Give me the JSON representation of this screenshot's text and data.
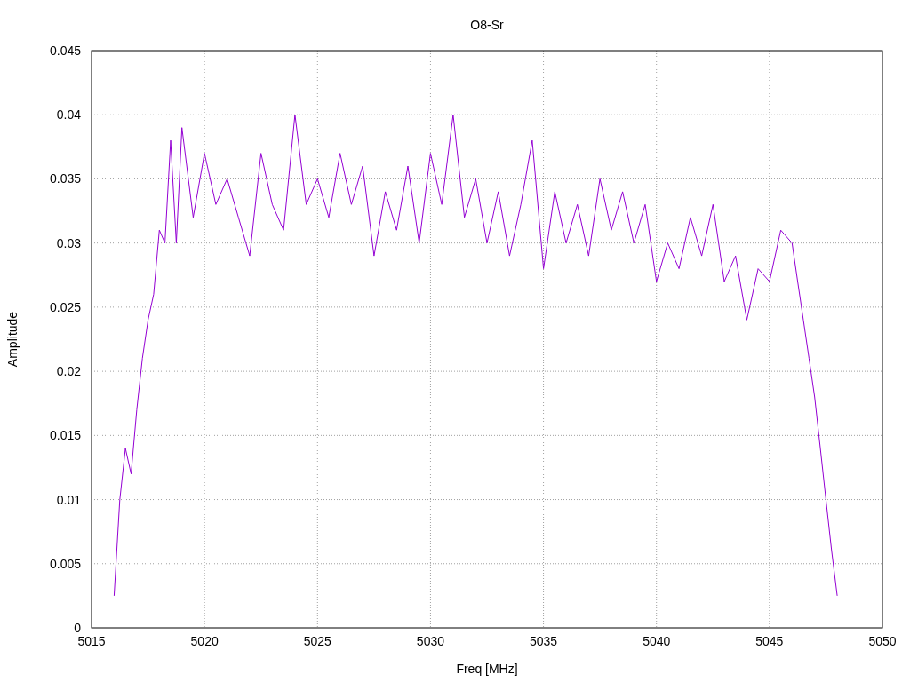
{
  "chart_data": {
    "type": "line",
    "title": "O8-Sr",
    "xlabel": "Freq [MHz]",
    "ylabel": "Amplitude",
    "grid": true,
    "xlim": [
      5015,
      5050
    ],
    "ylim": [
      0,
      0.045
    ],
    "xticks": [
      5015,
      5020,
      5025,
      5030,
      5035,
      5040,
      5045,
      5050
    ],
    "yticks": [
      0,
      0.005,
      0.01,
      0.015,
      0.02,
      0.025,
      0.03,
      0.035,
      0.04,
      0.045
    ],
    "x": [
      5016,
      5016.25,
      5016.5,
      5016.75,
      5017,
      5017.25,
      5017.5,
      5017.75,
      5018,
      5018.25,
      5018.5,
      5018.75,
      5019,
      5019.5,
      5020,
      5020.5,
      5021,
      5021.5,
      5022,
      5022.5,
      5023,
      5023.5,
      5024,
      5024.5,
      5025,
      5025.5,
      5026,
      5026.5,
      5027,
      5027.5,
      5028,
      5028.5,
      5029,
      5029.5,
      5030,
      5030.5,
      5031,
      5031.5,
      5032,
      5032.5,
      5033,
      5033.5,
      5034,
      5034.5,
      5035,
      5035.5,
      5036,
      5036.5,
      5037,
      5037.5,
      5038,
      5038.5,
      5039,
      5039.5,
      5040,
      5040.5,
      5041,
      5041.5,
      5042,
      5042.5,
      5043,
      5043.5,
      5044,
      5044.5,
      5045,
      5045.5,
      5046,
      5046.25,
      5046.5,
      5046.75,
      5047,
      5047.25,
      5047.5,
      5047.75,
      5048
    ],
    "series": [
      {
        "color": "#9400d3",
        "values": [
          0.0025,
          0.01,
          0.014,
          0.012,
          0.017,
          0.021,
          0.024,
          0.026,
          0.031,
          0.03,
          0.038,
          0.03,
          0.039,
          0.032,
          0.037,
          0.033,
          0.035,
          0.032,
          0.029,
          0.037,
          0.033,
          0.031,
          0.04,
          0.033,
          0.035,
          0.032,
          0.037,
          0.033,
          0.036,
          0.029,
          0.034,
          0.031,
          0.036,
          0.03,
          0.037,
          0.033,
          0.04,
          0.032,
          0.035,
          0.03,
          0.034,
          0.029,
          0.033,
          0.038,
          0.028,
          0.034,
          0.03,
          0.033,
          0.029,
          0.035,
          0.031,
          0.034,
          0.03,
          0.033,
          0.027,
          0.03,
          0.028,
          0.032,
          0.029,
          0.033,
          0.027,
          0.029,
          0.024,
          0.028,
          0.027,
          0.031,
          0.03,
          0.027,
          0.024,
          0.021,
          0.018,
          0.014,
          0.01,
          0.006,
          0.0025
        ]
      }
    ]
  }
}
